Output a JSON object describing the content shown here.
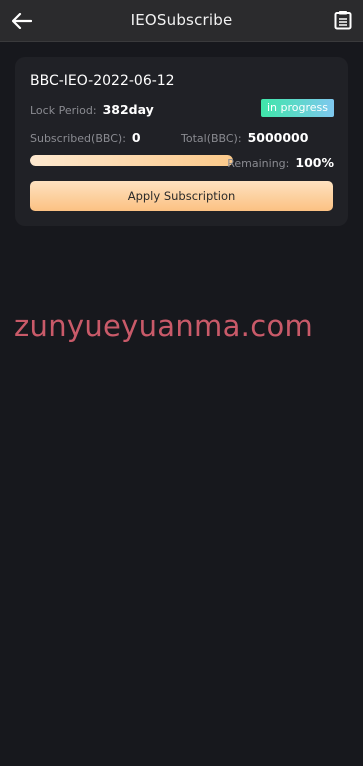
{
  "header": {
    "title": "IEOSubscribe",
    "back_icon": "arrow-left-icon",
    "record_icon": "document-list-icon"
  },
  "card": {
    "title": "BBC-IEO-2022-06-12",
    "lock_period_label": "Lock Period:",
    "lock_period_value": "382day",
    "status": "in progress",
    "subscribed_label": "Subscribed(BBC):",
    "subscribed_value": "0",
    "total_label": "Total(BBC):",
    "total_value": "5000000",
    "remaining_label": "Remaining:",
    "remaining_value": "100%",
    "remaining_fraction": 1.0,
    "apply_label": "Apply Subscription"
  },
  "watermark": "zunyueyuanma.com",
  "colors": {
    "background": "#17181d",
    "header": "#2b2b2d",
    "card": "#202126",
    "badge_start": "#3fe6a9",
    "badge_end": "#7fc8ef",
    "button_start": "#fee2c0",
    "button_end": "#fbc183",
    "watermark": "#c95a69"
  }
}
